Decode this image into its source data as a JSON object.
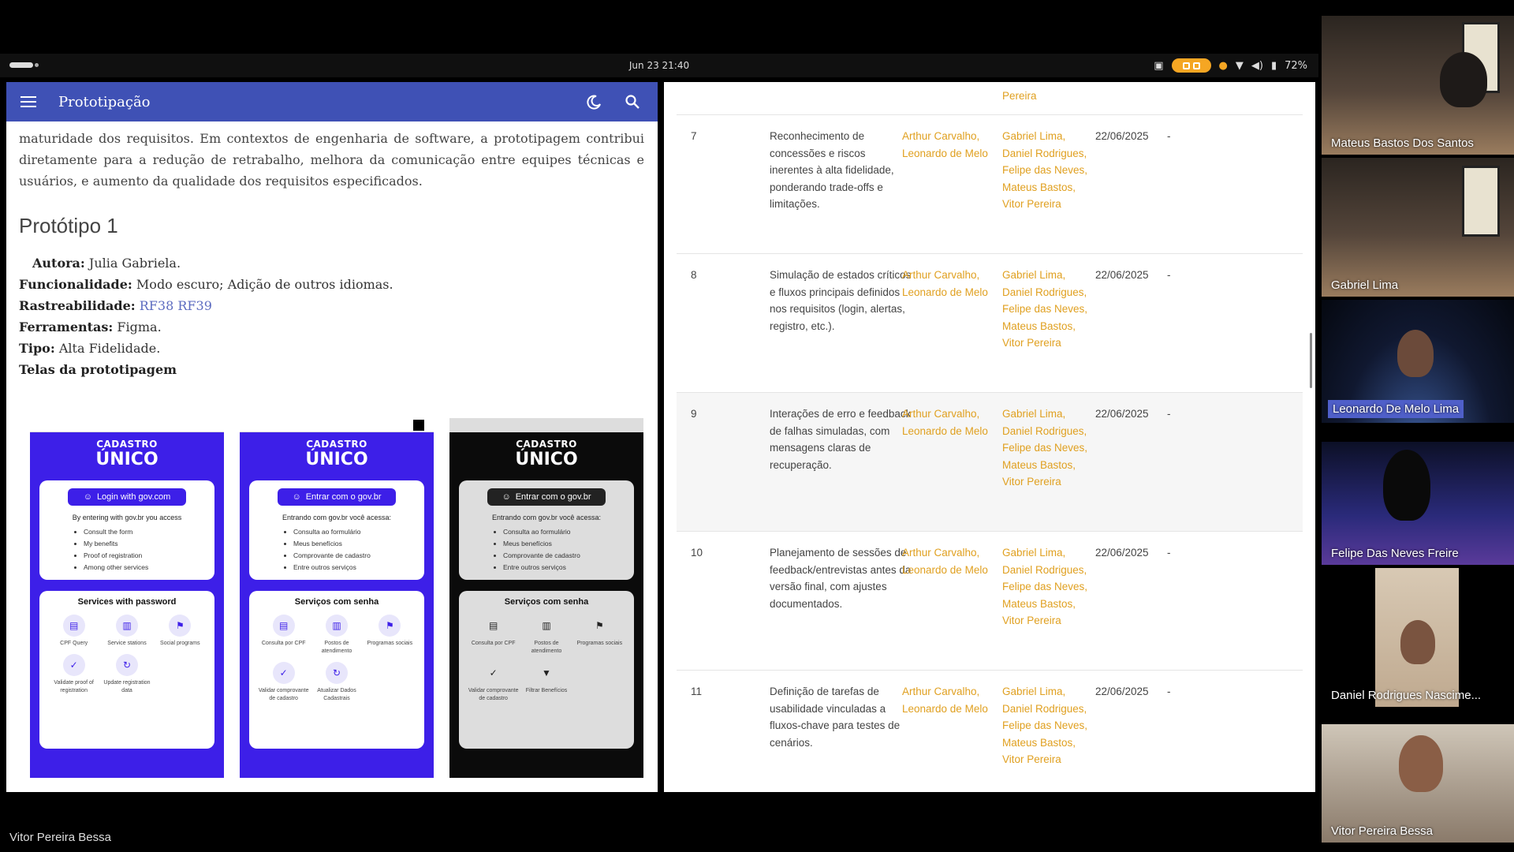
{
  "system": {
    "clock": "Jun 23  21:40",
    "battery": "72%"
  },
  "doc_app": {
    "title": "Prototipação",
    "intro": "maturidade dos requisitos. Em contextos de engenharia de software, a prototipagem contribui diretamente para a redução de retrabalho, melhora da comunicação entre equipes técnicas e usuários, e aumento da qualidade dos requisitos especificados.",
    "section_title": "Protótipo 1",
    "author_label": "Autora:",
    "author_value": "Julia Gabriela.",
    "func_label": "Funcionalidade:",
    "func_value": "Modo escuro; Adição de outros idiomas.",
    "trace_label": "Rastreabilidade:",
    "trace_links": [
      "RF38",
      "RF39"
    ],
    "tools_label": "Ferramentas:",
    "tools_value": "Figma.",
    "type_label": "Tipo:",
    "type_value": "Alta Fidelidade.",
    "screens_label": "Telas da prototipagem"
  },
  "prototypes": [
    {
      "top_label": "CADASTRO",
      "big_label": "ÚNICO",
      "login": "Login with gov.com",
      "intro": "By entering with gov.br you access",
      "bullets": [
        "Consult the form",
        "My benefits",
        "Proof of registration",
        "Among other services"
      ],
      "services_title": "Services with password",
      "services": [
        "CPF Query",
        "Service stations",
        "Social programs",
        "Validate proof of registration",
        "Update registration data"
      ]
    },
    {
      "top_label": "CADASTRO",
      "big_label": "ÚNICO",
      "login": "Entrar com o gov.br",
      "intro": "Entrando com gov.br você acessa:",
      "bullets": [
        "Consulta ao formulário",
        "Meus benefícios",
        "Comprovante de cadastro",
        "Entre outros serviços"
      ],
      "services_title": "Serviços com senha",
      "services": [
        "Consulta por CPF",
        "Postos de atendimento",
        "Programas sociais",
        "Validar comprovante de cadastro",
        "Atualizar Dados Cadastrais"
      ]
    },
    {
      "top_label": "CADASTRO",
      "big_label": "ÚNICO",
      "login": "Entrar com o gov.br",
      "intro": "Entrando com gov.br você acessa:",
      "bullets": [
        "Consulta ao formulário",
        "Meus benefícios",
        "Comprovante de cadastro",
        "Entre outros serviços"
      ],
      "services_title": "Serviços com senha",
      "services": [
        "Consulta por CPF",
        "Postos de atendimento",
        "Programas sociais",
        "Validar comprovante de cadastro",
        "Filtrar Benefícios"
      ]
    }
  ],
  "table": {
    "top_stub": "Pereira",
    "rows": [
      {
        "num": "7",
        "desc": "Reconhecimento de concessões e riscos inerentes à alta fidelidade, ponderando trade-offs e limitações.",
        "resp": "Arthur Carvalho, Leonardo de Melo",
        "part": "Gabriel Lima, Daniel Rodrigues, Felipe das Neves, Mateus Bastos, Vitor Pereira",
        "date": "22/06/2025",
        "dash": "-"
      },
      {
        "num": "8",
        "desc": "Simulação de estados críticos e fluxos principais definidos nos requisitos (login, alertas, registro, etc.).",
        "resp": "Arthur Carvalho, Leonardo de Melo",
        "part": "Gabriel Lima, Daniel Rodrigues, Felipe das Neves, Mateus Bastos, Vitor Pereira",
        "date": "22/06/2025",
        "dash": "-"
      },
      {
        "num": "9",
        "desc": "Interações de erro e feedback de falhas simuladas, com mensagens claras de recuperação.",
        "resp": "Arthur Carvalho, Leonardo de Melo",
        "part": "Gabriel Lima, Daniel Rodrigues, Felipe das Neves, Mateus Bastos, Vitor Pereira",
        "date": "22/06/2025",
        "dash": "-"
      },
      {
        "num": "10",
        "desc": "Planejamento de sessões de feedback/entrevistas antes da versão final, com ajustes documentados.",
        "resp": "Arthur Carvalho, Leonardo de Melo",
        "part": "Gabriel Lima, Daniel Rodrigues, Felipe das Neves, Mateus Bastos, Vitor Pereira",
        "date": "22/06/2025",
        "dash": "-"
      },
      {
        "num": "11",
        "desc": "Definição de tarefas de usabilidade vinculadas a fluxos-chave para testes de cenários.",
        "resp": "Arthur Carvalho, Leonardo de Melo",
        "part": "Gabriel Lima, Daniel Rodrigues, Felipe das Neves, Mateus Bastos, Vitor Pereira",
        "date": "22/06/2025",
        "dash": "-"
      }
    ]
  },
  "participants": [
    "Mateus Bastos Dos Santos",
    "Gabriel Lima",
    "Leonardo De Melo Lima",
    "Felipe Das Neves Freire",
    "Daniel Rodrigues Nascime...",
    "Vitor Pereira Bessa"
  ],
  "presenter": "Vitor Pereira Bessa",
  "colors": {
    "app_bar": "#3f51b5",
    "link": "#5c6bc0",
    "name_link": "#e0a020",
    "proto_blue": "#3d1fe8",
    "highlight": "#4f5fc9"
  }
}
